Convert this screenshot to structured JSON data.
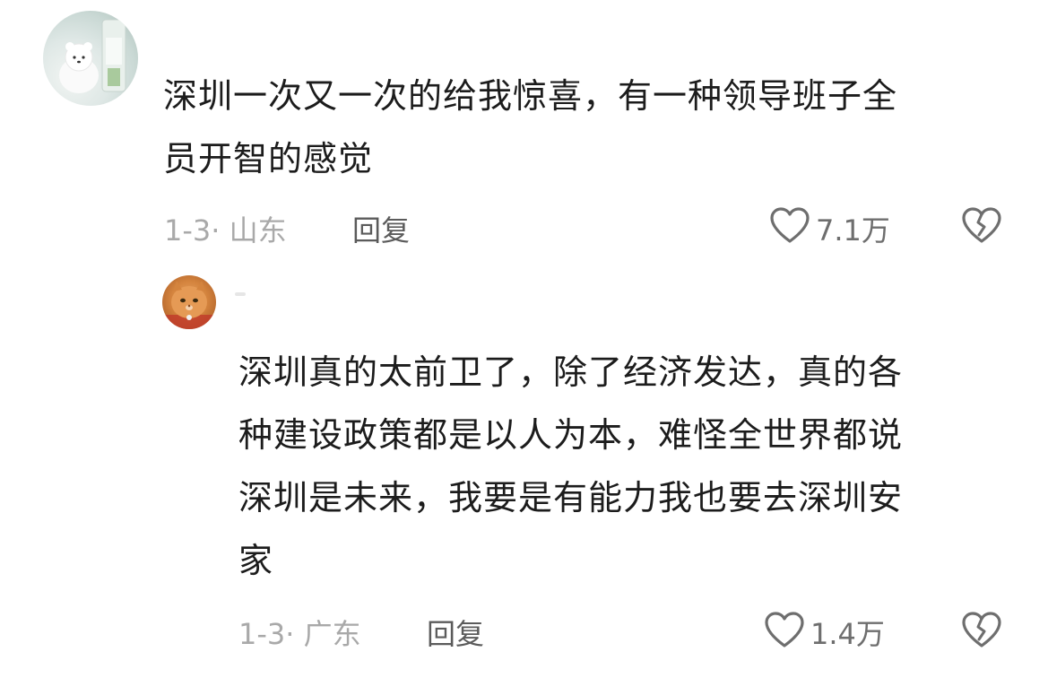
{
  "comments": [
    {
      "text_lines": [
        "深圳一次又一次的给我惊喜，有一种领导班子全",
        "员开智的感觉"
      ],
      "date_location": "1-3· 山东",
      "reply_label": "回复",
      "likes": "7.1万",
      "like_icon": "heart-outline-icon",
      "dislike_icon": "broken-heart-icon"
    }
  ],
  "replies": [
    {
      "text_lines": [
        "深圳真的太前卫了，除了经济发达，真的各",
        "种建设政策都是以人为本，难怪全世界都说",
        "深圳是未来，我要是有能力我也要去深圳安",
        "家"
      ],
      "date_location": "1-3· 广东",
      "reply_label": "回复",
      "likes": "1.4万",
      "like_icon": "heart-outline-icon",
      "dislike_icon": "broken-heart-icon"
    }
  ]
}
